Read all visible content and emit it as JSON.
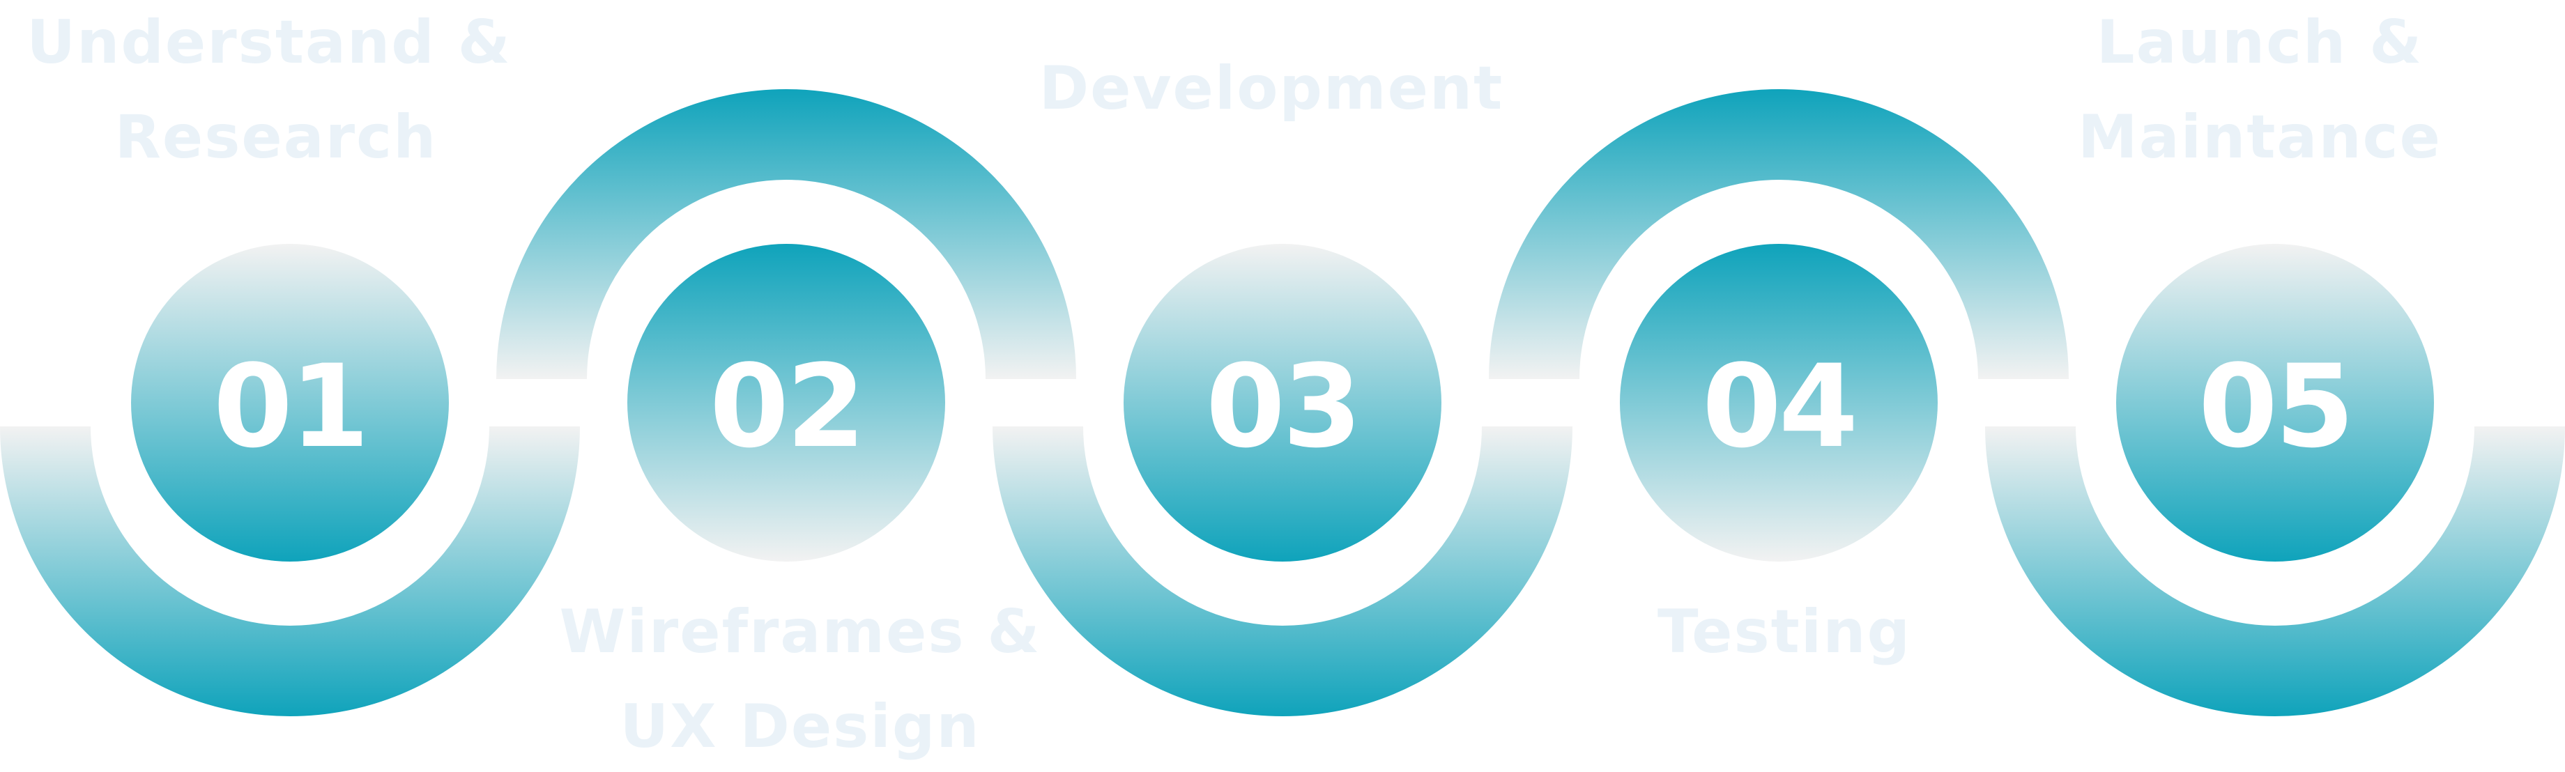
{
  "colors": {
    "teal": "#0fa3bb",
    "grey": "#f2f2f2",
    "label": "#eaf2f8",
    "number": "#ffffff"
  },
  "steps": [
    {
      "number": "01",
      "label_lines": [
        "Understand &",
        "Research"
      ]
    },
    {
      "number": "02",
      "label_lines": [
        "Wireframes &",
        "UX Design"
      ]
    },
    {
      "number": "03",
      "label_lines": [
        "Development"
      ]
    },
    {
      "number": "04",
      "label_lines": [
        "Testing"
      ]
    },
    {
      "number": "05",
      "label_lines": [
        "Launch &",
        "Maintance"
      ]
    }
  ]
}
